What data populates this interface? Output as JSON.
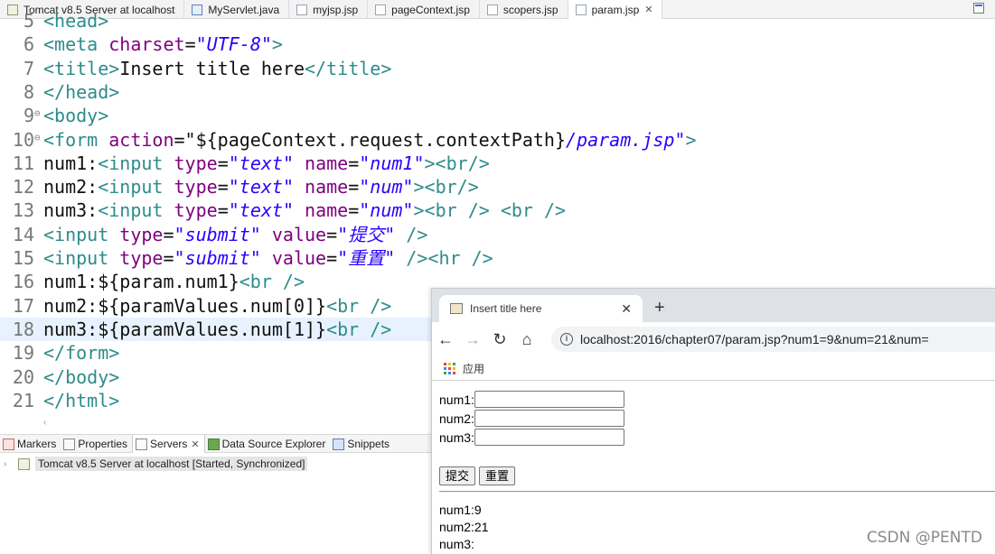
{
  "editor_tabs": [
    {
      "label": "Tomcat v8.5 Server at localhost",
      "icon": "server-icon"
    },
    {
      "label": "MyServlet.java",
      "icon": "java-file-icon"
    },
    {
      "label": "myjsp.jsp",
      "icon": "jsp-file-icon"
    },
    {
      "label": "pageContext.jsp",
      "icon": "jsp-file-icon"
    },
    {
      "label": "scopers.jsp",
      "icon": "jsp-file-icon"
    },
    {
      "label": "param.jsp",
      "icon": "jsp-file-icon",
      "active": true,
      "close": "✕"
    }
  ],
  "code_lines": [
    {
      "n": "5",
      "fold": "",
      "tokens": [
        [
          "tag",
          "<"
        ],
        [
          "el",
          "head"
        ],
        [
          "tag",
          ">"
        ]
      ]
    },
    {
      "n": "6",
      "fold": "",
      "tokens": [
        [
          "tag",
          "<"
        ],
        [
          "el",
          "meta "
        ],
        [
          "at",
          "charset"
        ],
        [
          "txt",
          "="
        ],
        [
          "val",
          "\"UTF-8\""
        ],
        [
          "tag",
          ">"
        ]
      ]
    },
    {
      "n": "7",
      "fold": "",
      "tokens": [
        [
          "tag",
          "<"
        ],
        [
          "el",
          "title"
        ],
        [
          "tag",
          ">"
        ],
        [
          "txt",
          "Insert title here"
        ],
        [
          "tag",
          "</"
        ],
        [
          "el",
          "title"
        ],
        [
          "tag",
          ">"
        ]
      ]
    },
    {
      "n": "8",
      "fold": "",
      "tokens": [
        [
          "tag",
          "</"
        ],
        [
          "el",
          "head"
        ],
        [
          "tag",
          ">"
        ]
      ]
    },
    {
      "n": "9",
      "fold": "⊖",
      "tokens": [
        [
          "tag",
          "<"
        ],
        [
          "el",
          "body"
        ],
        [
          "tag",
          ">"
        ]
      ]
    },
    {
      "n": "10",
      "fold": "⊖",
      "tokens": [
        [
          "tag",
          "<"
        ],
        [
          "el",
          "form "
        ],
        [
          "at",
          "action"
        ],
        [
          "txt",
          "=\"${pageContext.request.contextPath}"
        ],
        [
          "val",
          "/param.jsp\""
        ],
        [
          "tag",
          ">"
        ]
      ]
    },
    {
      "n": "11",
      "fold": "",
      "tokens": [
        [
          "txt",
          "num1:"
        ],
        [
          "tag",
          "<"
        ],
        [
          "el",
          "input "
        ],
        [
          "at",
          "type"
        ],
        [
          "txt",
          "="
        ],
        [
          "val",
          "\"text\""
        ],
        [
          "txt",
          " "
        ],
        [
          "at",
          "name"
        ],
        [
          "txt",
          "="
        ],
        [
          "val",
          "\"num1\""
        ],
        [
          "tag",
          ">"
        ],
        [
          "tag",
          "<"
        ],
        [
          "el",
          "br"
        ],
        [
          "tag",
          "/>"
        ]
      ]
    },
    {
      "n": "12",
      "fold": "",
      "tokens": [
        [
          "txt",
          "num2:"
        ],
        [
          "tag",
          "<"
        ],
        [
          "el",
          "input "
        ],
        [
          "at",
          "type"
        ],
        [
          "txt",
          "="
        ],
        [
          "val",
          "\"text\""
        ],
        [
          "txt",
          " "
        ],
        [
          "at",
          "name"
        ],
        [
          "txt",
          "="
        ],
        [
          "val",
          "\"num\""
        ],
        [
          "tag",
          ">"
        ],
        [
          "tag",
          "<"
        ],
        [
          "el",
          "br"
        ],
        [
          "tag",
          "/>"
        ]
      ]
    },
    {
      "n": "13",
      "fold": "",
      "tokens": [
        [
          "txt",
          "num3:"
        ],
        [
          "tag",
          "<"
        ],
        [
          "el",
          "input "
        ],
        [
          "at",
          "type"
        ],
        [
          "txt",
          "="
        ],
        [
          "val",
          "\"text\""
        ],
        [
          "txt",
          " "
        ],
        [
          "at",
          "name"
        ],
        [
          "txt",
          "="
        ],
        [
          "val",
          "\"num\""
        ],
        [
          "tag",
          ">"
        ],
        [
          "tag",
          "<"
        ],
        [
          "el",
          "br "
        ],
        [
          "tag",
          "/>"
        ],
        [
          "txt",
          " "
        ],
        [
          "tag",
          "<"
        ],
        [
          "el",
          "br "
        ],
        [
          "tag",
          "/>"
        ]
      ]
    },
    {
      "n": "14",
      "fold": "",
      "tokens": [
        [
          "tag",
          "<"
        ],
        [
          "el",
          "input "
        ],
        [
          "at",
          "type"
        ],
        [
          "txt",
          "="
        ],
        [
          "val",
          "\"submit\""
        ],
        [
          "txt",
          " "
        ],
        [
          "at",
          "value"
        ],
        [
          "txt",
          "="
        ],
        [
          "val",
          "\"提交\""
        ],
        [
          "txt",
          " "
        ],
        [
          "tag",
          "/>"
        ]
      ]
    },
    {
      "n": "15",
      "fold": "",
      "tokens": [
        [
          "tag",
          "<"
        ],
        [
          "el",
          "input "
        ],
        [
          "at",
          "type"
        ],
        [
          "txt",
          "="
        ],
        [
          "val",
          "\"submit\""
        ],
        [
          "txt",
          " "
        ],
        [
          "at",
          "value"
        ],
        [
          "txt",
          "="
        ],
        [
          "val",
          "\"重置\""
        ],
        [
          "txt",
          " "
        ],
        [
          "tag",
          "/>"
        ],
        [
          "tag",
          "<"
        ],
        [
          "el",
          "hr "
        ],
        [
          "tag",
          "/>"
        ]
      ]
    },
    {
      "n": "16",
      "fold": "",
      "tokens": [
        [
          "txt",
          "num1:${param.num1}"
        ],
        [
          "tag",
          "<"
        ],
        [
          "el",
          "br "
        ],
        [
          "tag",
          "/>"
        ]
      ]
    },
    {
      "n": "17",
      "fold": "",
      "tokens": [
        [
          "txt",
          "num2:${paramValues.num[0]}"
        ],
        [
          "tag",
          "<"
        ],
        [
          "el",
          "br "
        ],
        [
          "tag",
          "/>"
        ]
      ]
    },
    {
      "n": "18",
      "fold": "",
      "hl": true,
      "tokens": [
        [
          "txt",
          "num3:${paramValues.num[1]}"
        ],
        [
          "tag",
          "<"
        ],
        [
          "el",
          "br "
        ],
        [
          "tag",
          "/>"
        ]
      ]
    },
    {
      "n": "19",
      "fold": "",
      "tokens": [
        [
          "tag",
          "</"
        ],
        [
          "el",
          "form"
        ],
        [
          "tag",
          ">"
        ]
      ]
    },
    {
      "n": "20",
      "fold": "",
      "tokens": [
        [
          "tag",
          "</"
        ],
        [
          "el",
          "body"
        ],
        [
          "tag",
          ">"
        ]
      ]
    },
    {
      "n": "21",
      "fold": "",
      "tokens": [
        [
          "tag",
          "</"
        ],
        [
          "el",
          "html"
        ],
        [
          "tag",
          ">"
        ]
      ]
    }
  ],
  "panel_tabs": [
    {
      "label": "Markers",
      "icon": "markers-icon",
      "cls": "red"
    },
    {
      "label": "Properties",
      "icon": "properties-icon",
      "cls": ""
    },
    {
      "label": "Servers",
      "icon": "servers-icon",
      "cls": "",
      "active": true,
      "close": "✕"
    },
    {
      "label": "Data Source Explorer",
      "icon": "data-source-icon",
      "cls": "green"
    },
    {
      "label": "Snippets",
      "icon": "snippets-icon",
      "cls": "blue"
    }
  ],
  "server_entry": "Tomcat v8.5 Server at localhost  [Started, Synchronized]",
  "browser": {
    "tab_title": "Insert title here",
    "tab_close": "✕",
    "new_tab": "+",
    "back": "←",
    "forward": "→",
    "reload": "↻",
    "home": "⌂",
    "url": "localhost:2016/chapter07/param.jsp?num1=9&num=21&num=",
    "info": "i",
    "bookmark_apps": "应用",
    "apps_colors": [
      "#ea4335",
      "#fbbc05",
      "#34a853",
      "#4285f4",
      "#ea4335",
      "#fbbc05",
      "#34a853",
      "#4285f4",
      "#ea4335"
    ]
  },
  "form": {
    "fields": [
      {
        "label": "num1:",
        "value": ""
      },
      {
        "label": "num2:",
        "value": ""
      },
      {
        "label": "num3:",
        "value": ""
      }
    ],
    "submit_label": "提交",
    "reset_label": "重置"
  },
  "output": [
    "num1:9",
    "num2:21",
    "num3:"
  ],
  "watermark": "CSDN @PENTD"
}
